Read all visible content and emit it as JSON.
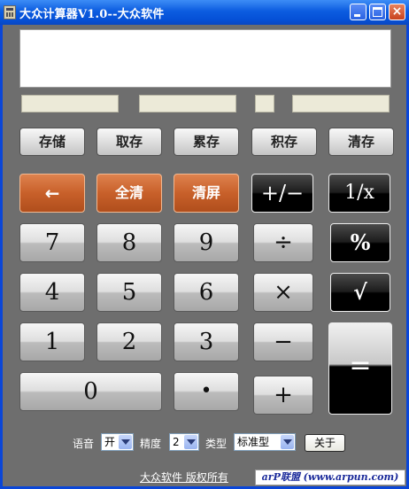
{
  "window": {
    "title": "大众计算器V1.0--大众软件"
  },
  "titlebar_buttons": {
    "close": "×"
  },
  "memory_buttons": [
    "存储",
    "取存",
    "累存",
    "积存",
    "清存"
  ],
  "row2": {
    "backspace": "←",
    "clear_all": "全清",
    "clear_screen": "清屏",
    "sign": "+/−",
    "reciprocal": "1/x"
  },
  "digits": {
    "seven": "7",
    "eight": "8",
    "nine": "9",
    "four": "4",
    "five": "5",
    "six": "6",
    "one": "1",
    "two": "2",
    "three": "3",
    "zero": "0",
    "dot": "•"
  },
  "operators": {
    "divide": "÷",
    "percent": "%",
    "multiply": "×",
    "sqrt": "√",
    "minus": "−",
    "plus": "+",
    "equals": "="
  },
  "options": {
    "voice_label": "语音",
    "voice_value": "开",
    "precision_label": "精度",
    "precision_value": "2",
    "type_label": "类型",
    "type_value": "标准型",
    "about_label": "关于"
  },
  "footer": {
    "copyright": "大众软件 版权所有",
    "watermark": "arP联盟 (www.arpun.com)"
  },
  "colors": {
    "accent_orange": "#c8602a",
    "window_bg": "#6e6e6e",
    "titlebar_blue": "#0550d6"
  }
}
